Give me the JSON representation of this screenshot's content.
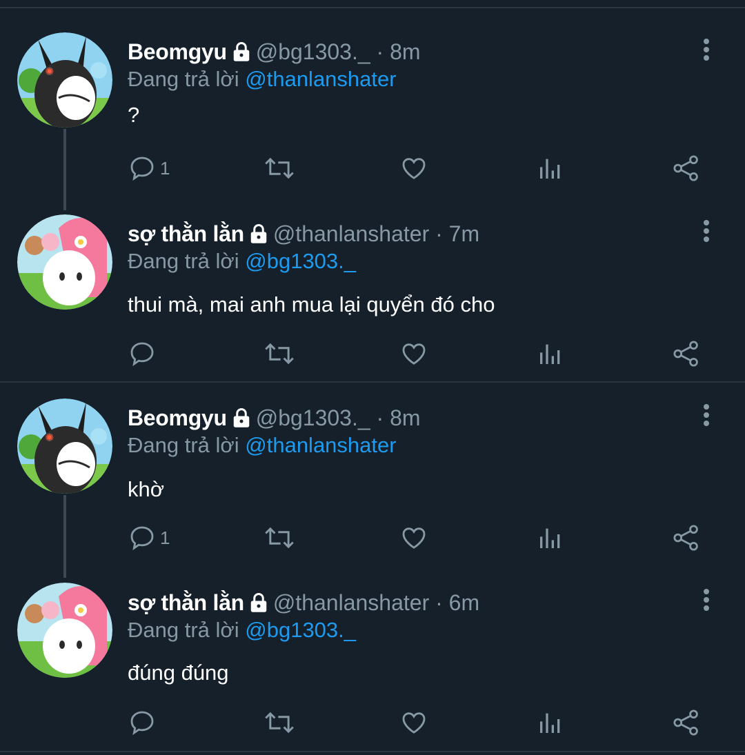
{
  "tweets": [
    {
      "name": "Beomgyu",
      "handle": "@bg1303._",
      "dot": "·",
      "time": "8m",
      "replying_prefix": "Đang trả lời",
      "replying_to": "@thanlanshater",
      "text": "?",
      "reply_count": "1",
      "avatar": "dark-bunny-avatar"
    },
    {
      "name": "sợ thằn lằn",
      "handle": "@thanlanshater",
      "dot": "·",
      "time": "7m",
      "replying_prefix": "Đang trả lời",
      "replying_to": "@bg1303._",
      "text": "thui mà, mai anh mua lại quyển đó cho",
      "reply_count": "",
      "avatar": "pink-bunny-avatar"
    },
    {
      "name": "Beomgyu",
      "handle": "@bg1303._",
      "dot": "·",
      "time": "8m",
      "replying_prefix": "Đang trả lời",
      "replying_to": "@thanlanshater",
      "text": "khờ",
      "reply_count": "1",
      "avatar": "dark-bunny-avatar"
    },
    {
      "name": "sợ thằn lằn",
      "handle": "@thanlanshater",
      "dot": "·",
      "time": "6m",
      "replying_prefix": "Đang trả lời",
      "replying_to": "@bg1303._",
      "text": "đúng đúng",
      "reply_count": "",
      "avatar": "pink-bunny-avatar"
    }
  ],
  "icons": {
    "lock": "lock-icon",
    "more": "more-vertical-icon",
    "reply": "reply-icon",
    "retweet": "retweet-icon",
    "like": "heart-icon",
    "views": "views-icon",
    "share": "share-icon"
  },
  "colors": {
    "background": "#15202b",
    "muted": "#8899a6",
    "link": "#1d9bf0",
    "divider": "#2a3540"
  }
}
